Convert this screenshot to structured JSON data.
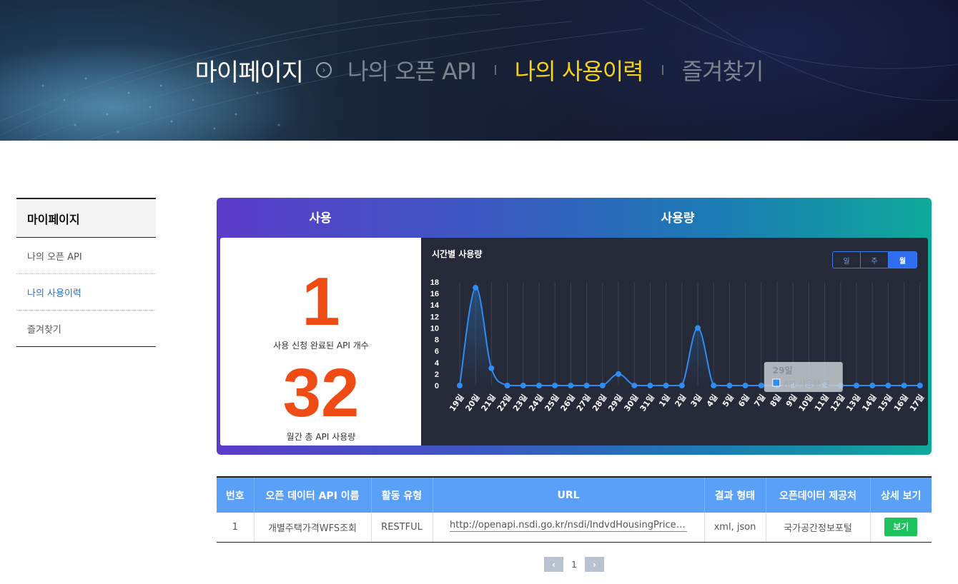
{
  "hero": {
    "title": "마이페이지",
    "arrow_icon": "chevron-right-circle-icon",
    "links": [
      {
        "label": "나의 오픈 API",
        "active": false
      },
      {
        "label": "나의 사용이력",
        "active": true
      },
      {
        "label": "즐겨찾기",
        "active": false
      }
    ],
    "active_color": "#f3d21a"
  },
  "sidebar": {
    "title": "마이페이지",
    "items": [
      {
        "label": "나의 오픈 API",
        "active": false
      },
      {
        "label": "나의 사용이력",
        "active": true
      },
      {
        "label": "즐겨찾기",
        "active": false
      }
    ]
  },
  "usage": {
    "left_header": "사용",
    "right_header": "사용량",
    "api_count": "1",
    "api_count_label": "사용 신청 완료된 API 개수",
    "total_usage": "32",
    "total_usage_label": "월간 총 API 사용량",
    "accent_color": "#ef4b14",
    "chart_title": "시간별 사용량",
    "period_tabs": [
      {
        "label": "일",
        "active": false
      },
      {
        "label": "주",
        "active": false
      },
      {
        "label": "월",
        "active": true
      }
    ],
    "tooltip": {
      "title": "29일",
      "text": "API 사용량: 2"
    }
  },
  "chart_data": {
    "type": "line",
    "categories": [
      "19일",
      "20일",
      "21일",
      "22일",
      "23일",
      "24일",
      "25일",
      "26일",
      "27일",
      "28일",
      "29일",
      "30일",
      "31일",
      "1일",
      "2일",
      "3일",
      "4일",
      "5일",
      "6일",
      "7일",
      "8일",
      "9일",
      "10일",
      "11일",
      "12일",
      "13일",
      "14일",
      "15일",
      "16일",
      "17일"
    ],
    "series": [
      {
        "values": [
          0,
          17,
          3,
          0,
          0,
          0,
          0,
          0,
          0,
          0,
          2,
          0,
          0,
          0,
          0,
          10,
          0,
          0,
          0,
          0,
          0,
          0,
          0,
          0,
          0,
          0,
          0,
          0,
          0,
          0
        ]
      }
    ],
    "yticks": [
      0,
      2,
      4,
      6,
      8,
      10,
      12,
      14,
      16,
      18
    ],
    "ylim": [
      0,
      18
    ],
    "grid": true,
    "line_color": "#2f8cf0"
  },
  "table": {
    "headers": [
      "번호",
      "오픈 데이터 API 이름",
      "활동 유형",
      "URL",
      "결과 형태",
      "오픈데이터 제공처",
      "상세 보기"
    ],
    "rows": [
      {
        "no": "1",
        "name": "개별주택가격WFS조회",
        "type": "RESTFUL",
        "url": "http://openapi.nsdi.go.kr/nsdi/IndvdHousingPriceSe...",
        "format": "xml, json",
        "provider": "국가공간정보포털",
        "button": "보기"
      }
    ]
  },
  "pagination": {
    "prev_icon": "chevron-left-icon",
    "next_icon": "chevron-right-icon",
    "current": "1"
  }
}
